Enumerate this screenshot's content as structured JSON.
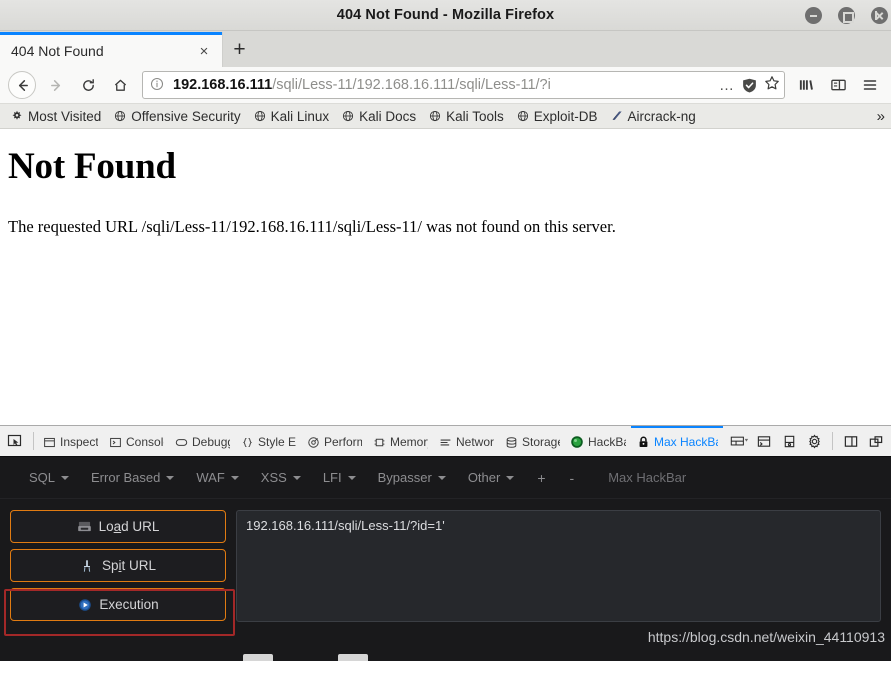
{
  "window": {
    "title": "404 Not Found - Mozilla Firefox",
    "controls": {
      "minimize": "minimize-button",
      "maximize": "maximize-button",
      "close": "close-button"
    }
  },
  "tabs": {
    "items": [
      {
        "label": "404 Not Found",
        "close": "×"
      }
    ],
    "new_tab": "+"
  },
  "navigation": {
    "back": "←",
    "forward": "→",
    "reload": "↻",
    "home": "⌂"
  },
  "urlbar": {
    "info_icon": "ⓘ",
    "host": "192.168.16.111",
    "path": "/sqli/Less-11/192.168.16.111/sqli/Less-11/?i",
    "page_actions": "…",
    "shield": "shield-icon",
    "bookmark_star": "☆"
  },
  "toolbar_right": {
    "library": "library-icon",
    "sidebar": "sidebar-icon",
    "menu": "≡"
  },
  "bookmarks": {
    "items": [
      {
        "label": "Most Visited",
        "icon": "⚙"
      },
      {
        "label": "Offensive Security",
        "icon": "⊕"
      },
      {
        "label": "Kali Linux",
        "icon": "⊕"
      },
      {
        "label": "Kali Docs",
        "icon": "⊕"
      },
      {
        "label": "Kali Tools",
        "icon": "⊕"
      },
      {
        "label": "Exploit-DB",
        "icon": "⊕"
      },
      {
        "label": "Aircrack-ng",
        "icon": "◢"
      }
    ],
    "overflow": "»"
  },
  "page": {
    "heading": "Not Found",
    "body": "The requested URL /sqli/Less-11/192.168.16.111/sqli/Less-11/ was not found on this server."
  },
  "devtools": {
    "picker": "element-picker-icon",
    "tabs": [
      {
        "label": "Inspector",
        "icon": "inspector-icon",
        "active": false
      },
      {
        "label": "Console",
        "icon": "console-icon",
        "active": false
      },
      {
        "label": "Debugger",
        "icon": "debugger-icon",
        "active": false
      },
      {
        "label": "Style Editor",
        "icon": "style-editor-icon",
        "active": false
      },
      {
        "label": "Performance",
        "icon": "performance-icon",
        "active": false
      },
      {
        "label": "Memory",
        "icon": "memory-icon",
        "active": false
      },
      {
        "label": "Network",
        "icon": "network-icon",
        "active": false
      },
      {
        "label": "Storage",
        "icon": "storage-icon",
        "active": false
      },
      {
        "label": "HackBar",
        "icon": "hackbar-icon",
        "active": false
      },
      {
        "label": "Max HackBar",
        "icon": "lock-icon",
        "active": true
      }
    ],
    "right_buttons": [
      {
        "name": "responsive-design-mode-icon"
      },
      {
        "name": "split-console-icon"
      },
      {
        "name": "screenshot-icon"
      },
      {
        "name": "devtools-settings-icon"
      },
      {
        "name": "dock-side-icon"
      },
      {
        "name": "dock-separate-window-icon"
      }
    ],
    "accent": "#0a84ff"
  },
  "hackbar": {
    "menu": [
      {
        "label": "SQL",
        "has_caret": true
      },
      {
        "label": "Error Based",
        "has_caret": true
      },
      {
        "label": "WAF",
        "has_caret": true
      },
      {
        "label": "XSS",
        "has_caret": true
      },
      {
        "label": "LFI",
        "has_caret": true
      },
      {
        "label": "Bypasser",
        "has_caret": true
      },
      {
        "label": "Other",
        "has_caret": true
      }
    ],
    "add": "+",
    "remove": "-",
    "brand": "Max HackBar",
    "buttons": [
      {
        "label_before": "Lo",
        "accel": "a",
        "label_after": "d URL",
        "icon": "load-url-icon",
        "name": "load-url-button"
      },
      {
        "label_before": "Sp",
        "accel": "i",
        "label_after": "t URL",
        "icon": "split-url-icon",
        "name": "split-url-button"
      },
      {
        "label_before": "",
        "accel": "",
        "label_after": "Execution",
        "icon": "execution-icon",
        "name": "execution-button"
      }
    ],
    "url_value": "192.168.16.111/sqli/Less-11/?id=1'",
    "url_placeholder": "",
    "border_color": "#e07b12",
    "highlight_color": "#a32828"
  },
  "watermark": "https://blog.csdn.net/weixin_44110913"
}
